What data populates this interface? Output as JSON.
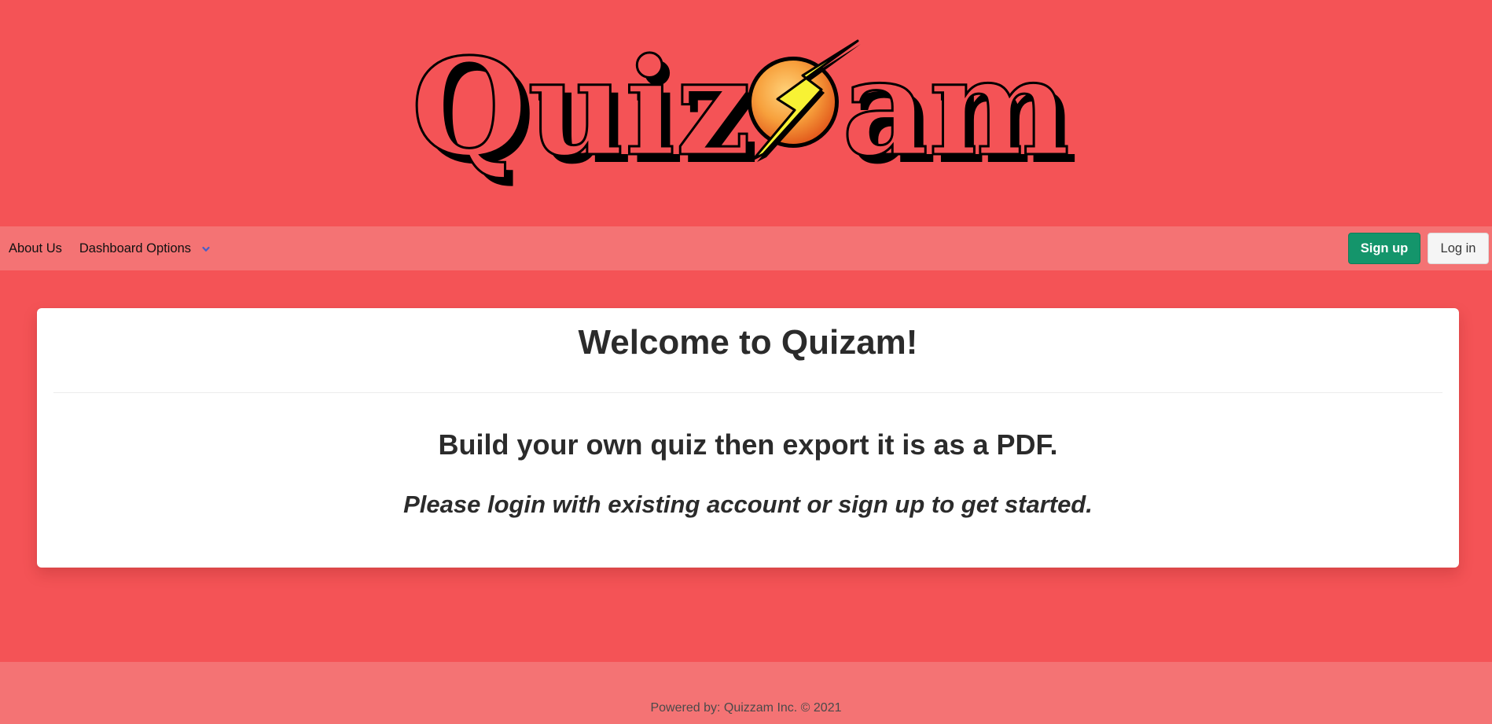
{
  "brand": {
    "logo_text_left": "Quiz",
    "logo_text_right": "am",
    "logo_alt": "Quizzam"
  },
  "nav": {
    "about_label": "About Us",
    "dashboard_label": "Dashboard Options",
    "dashboard_icon": "chevron-down-icon",
    "signup_label": "Sign up",
    "login_label": "Log in"
  },
  "card": {
    "title": "Welcome to Quizam!",
    "subtitle": "Build your own quiz then export it is as a PDF.",
    "prompt": "Please login with existing account or sign up to get started."
  },
  "footer": {
    "text": "Powered by: Quizzam Inc. © 2021"
  },
  "colors": {
    "page_bg": "#f45356",
    "bar_bg": "#f47374",
    "signup_bg": "#14956b",
    "chevron": "#485fc7"
  }
}
